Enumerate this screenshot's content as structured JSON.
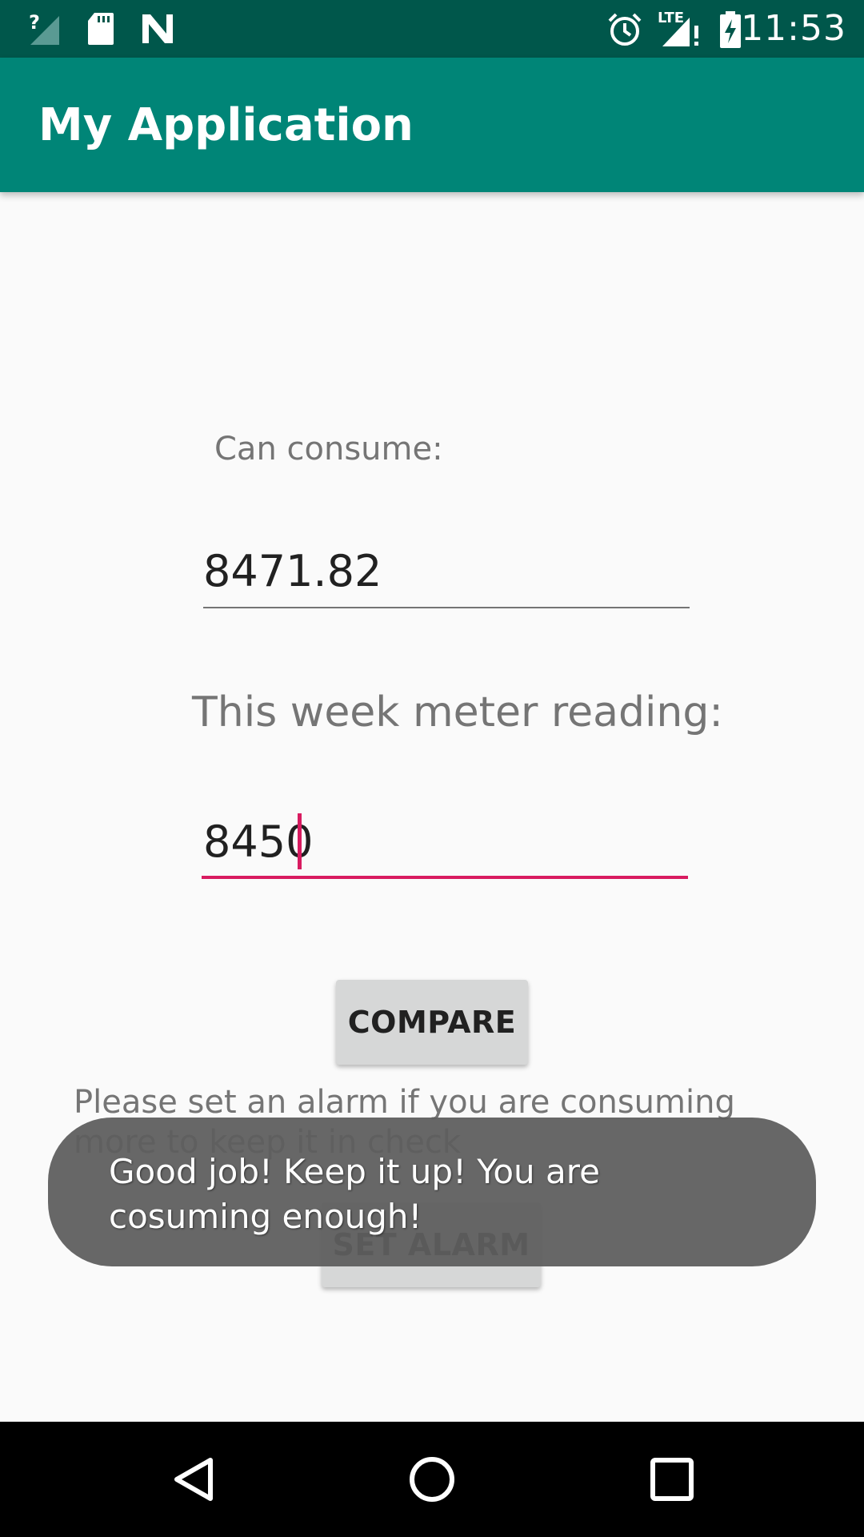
{
  "status_bar": {
    "time": "11:53",
    "icons": [
      "signal-unknown-icon",
      "sd-card-icon",
      "n-logo-icon",
      "alarm-icon",
      "lte-signal-icon",
      "battery-charging-icon"
    ],
    "lte_label": "LTE"
  },
  "app_bar": {
    "title": "My Application"
  },
  "form": {
    "can_consume_label": "Can consume:",
    "can_consume_value": "8471.82",
    "meter_label": "This week meter reading:",
    "meter_value": "8450"
  },
  "buttons": {
    "compare": "COMPARE",
    "set_alarm": "SET ALARM"
  },
  "info": {
    "text": "Please set an alarm if you are consuming more to keep it in check"
  },
  "toast": {
    "message": "Good job! Keep it up! You are cosuming enough!"
  },
  "nav_bar": {
    "icons": [
      "back-icon",
      "home-icon",
      "recents-icon"
    ]
  },
  "colors": {
    "primary": "#008577",
    "primary_dark": "#00574b",
    "accent": "#d81b60"
  }
}
